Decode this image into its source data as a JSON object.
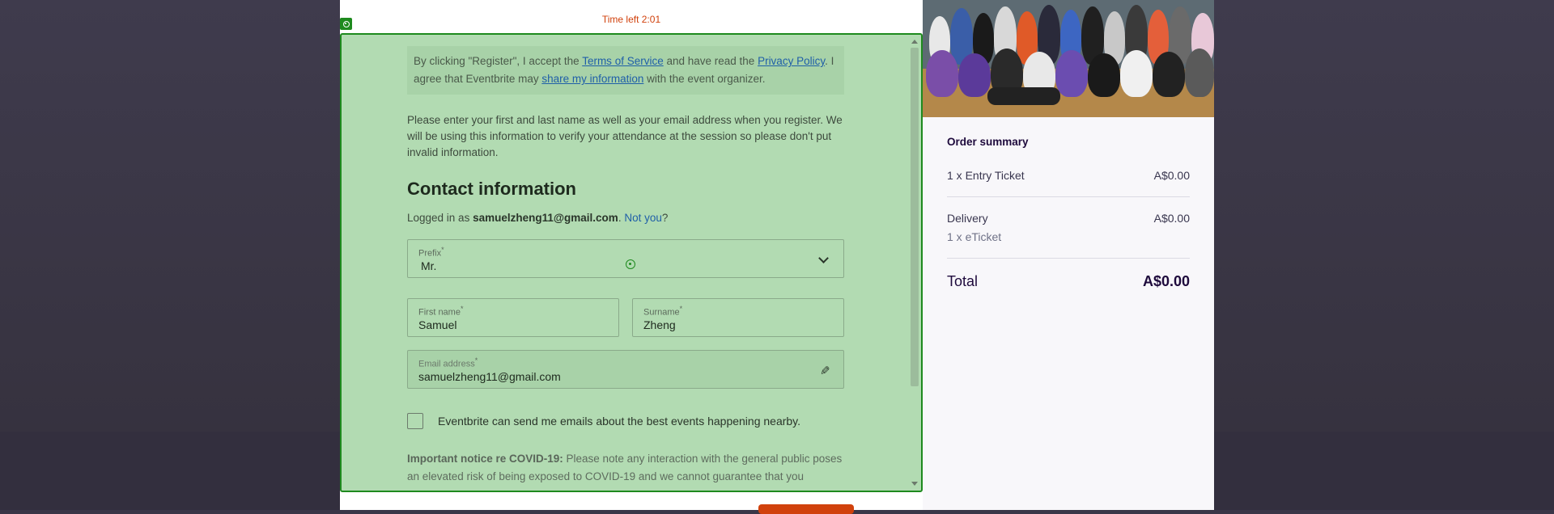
{
  "timer": {
    "text": "Time left 2:01"
  },
  "terms": {
    "part1": "By clicking \"Register\", I accept the ",
    "link_terms": "Terms of Service",
    "part2": " and have read the ",
    "link_privacy": "Privacy Policy",
    "part3": ". I agree that Eventbrite may ",
    "link_share": "share my information",
    "part4": " with the event organizer."
  },
  "note": "Please enter your first and last name as well as your email address when you register. We will be using this information to verify your attendance at the session so please don't put invalid information.",
  "contact": {
    "title": "Contact information",
    "logged_in_prefix": "Logged in as ",
    "email_bold": "samuelzheng11@gmail.com",
    "logged_in_sep": ". ",
    "not_you": "Not you",
    "question": "?"
  },
  "fields": {
    "prefix": {
      "label": "Prefix",
      "value": "Mr."
    },
    "first_name": {
      "label": "First name",
      "value": "Samuel"
    },
    "surname": {
      "label": "Surname",
      "value": "Zheng"
    },
    "email": {
      "label": "Email address",
      "value": "samuelzheng11@gmail.com"
    },
    "required_mark": "*"
  },
  "opt_in": {
    "label": "Eventbrite can send me emails about the best events happening nearby.",
    "checked": false
  },
  "covid": {
    "heading": "Important notice re COVID-19:",
    "text": " Please note any interaction with the general public poses an elevated risk of being exposed to COVID-19 and we cannot guarantee that you"
  },
  "order_summary": {
    "title": "Order summary",
    "line_item": {
      "label": "1 x Entry Ticket",
      "price": "A$0.00"
    },
    "delivery": {
      "label": "Delivery",
      "price": "A$0.00",
      "sub": "1 x eTicket"
    },
    "total": {
      "label": "Total",
      "price": "A$0.00"
    }
  },
  "colors": {
    "overlay": "#1e8a1e",
    "brand": "#d1410c",
    "link": "#1f5fa8"
  }
}
